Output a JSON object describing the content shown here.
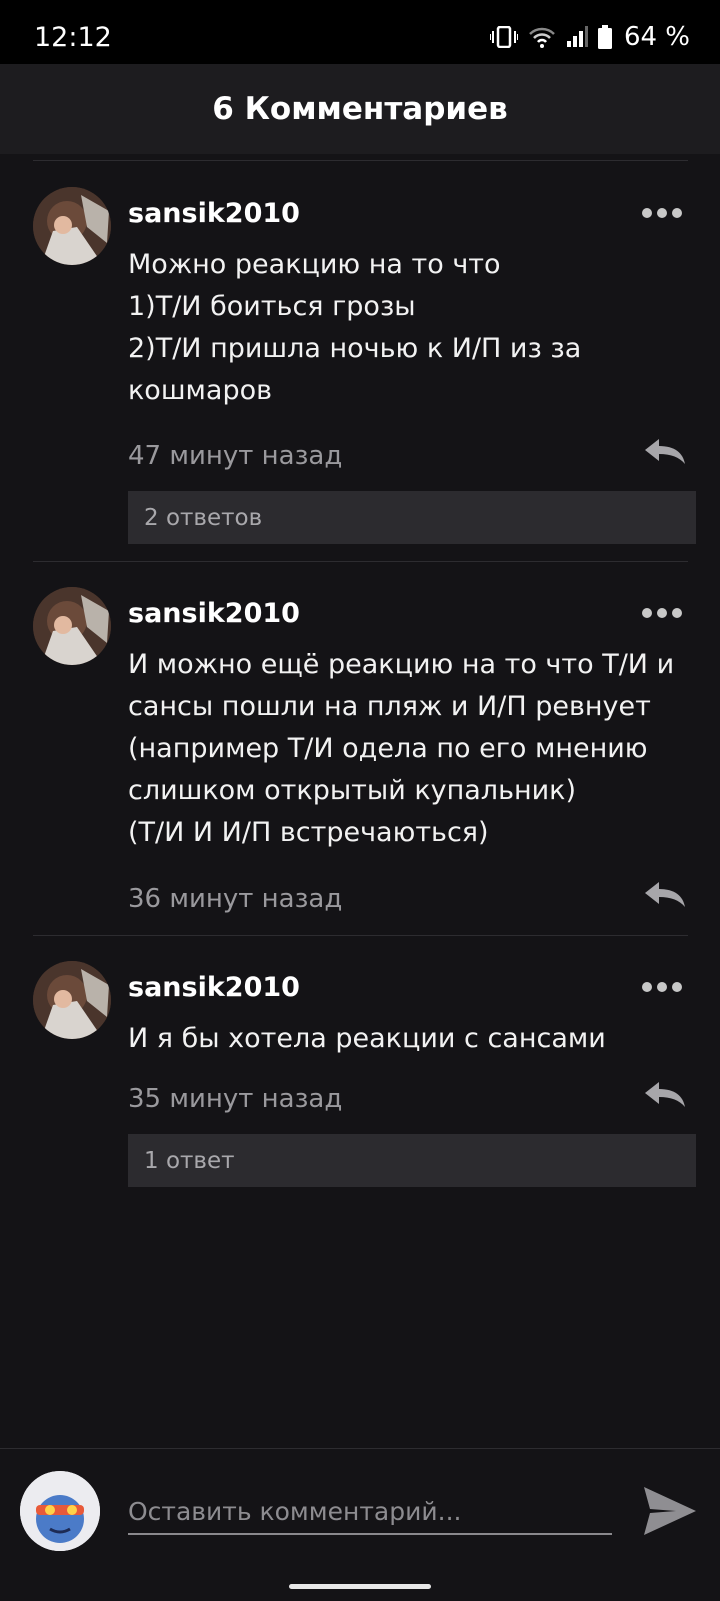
{
  "status_bar": {
    "time": "12:12",
    "battery": "64 %"
  },
  "header": {
    "title": "6 Комментариев"
  },
  "comments": [
    {
      "username": "sansik2010",
      "text": "Можно реакцию на то что\n1)Т/И боиться грозы\n2)Т/И пришла ночью к И/П из за кошмаров",
      "time": "47 минут назад",
      "replies": "2 ответов"
    },
    {
      "username": "sansik2010",
      "text": "И можно ещё реакцию на то что Т/И  и сансы пошли на пляж и И/П  ревнует (например Т/И одела по его мнению слишком открытый купальник)\n(Т/И И И/П встречаються)",
      "time": "36 минут назад",
      "replies": ""
    },
    {
      "username": "sansik2010",
      "text": "И я бы хотела реакции с сансами",
      "time": "35 минут назад",
      "replies": "1 ответ"
    }
  ],
  "composer": {
    "placeholder": "Оставить комментарий..."
  },
  "colors": {
    "background": "#141316",
    "header": "#1d1c1f",
    "replies_box": "#2c2b2f"
  }
}
